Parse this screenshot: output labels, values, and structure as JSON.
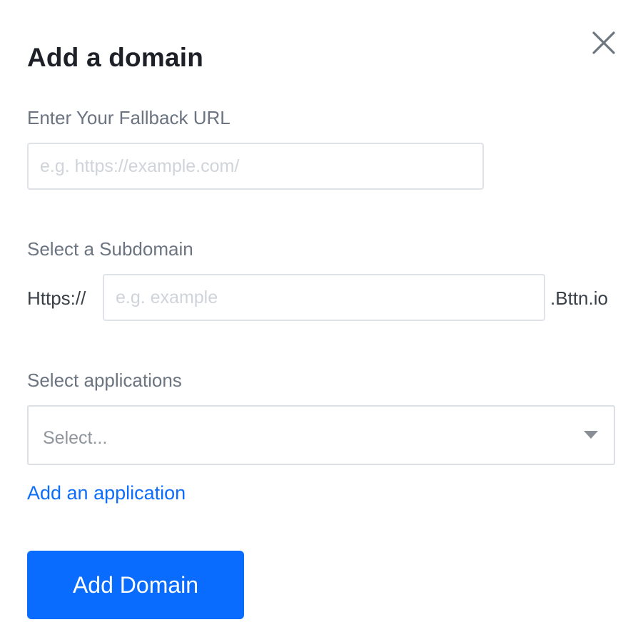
{
  "modal": {
    "title": "Add a domain",
    "close_icon": "close-icon"
  },
  "fallback": {
    "label": "Enter Your Fallback URL",
    "placeholder": "e.g. https://example.com/",
    "value": ""
  },
  "subdomain": {
    "label": "Select a Subdomain",
    "prefix": "Https://",
    "placeholder": "e.g. example",
    "value": "",
    "suffix": ".Bttn.io"
  },
  "applications": {
    "label": "Select applications",
    "selected": "Select...",
    "caret_icon": "caret-down-icon",
    "add_link": "Add an application"
  },
  "actions": {
    "submit_label": "Add Domain"
  },
  "colors": {
    "primary": "#0a6cff",
    "link": "#0d6efd",
    "label": "#6b7480",
    "title": "#1d2127"
  }
}
